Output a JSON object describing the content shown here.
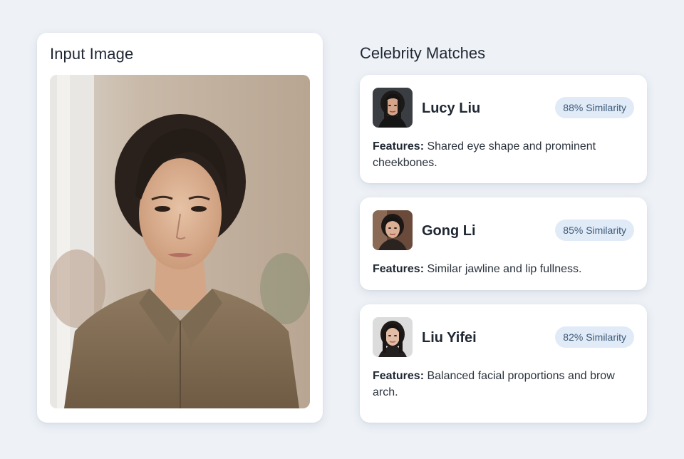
{
  "input_panel": {
    "title": "Input Image"
  },
  "matches_panel": {
    "title": "Celebrity Matches",
    "features_label": "Features:",
    "matches": [
      {
        "name": "Lucy Liu",
        "similarity": "88% Similarity",
        "features": "Shared eye shape and prominent cheekbones."
      },
      {
        "name": "Gong Li",
        "similarity": "85% Similarity",
        "features": "Similar jawline and lip fullness."
      },
      {
        "name": "Liu Yifei",
        "similarity": "82% Similarity",
        "features": "Balanced facial proportions and brow arch."
      }
    ]
  },
  "colors": {
    "background": "#eef2f7",
    "card": "#ffffff",
    "badge_bg": "#e1ebf7",
    "badge_text": "#3f5a78"
  }
}
